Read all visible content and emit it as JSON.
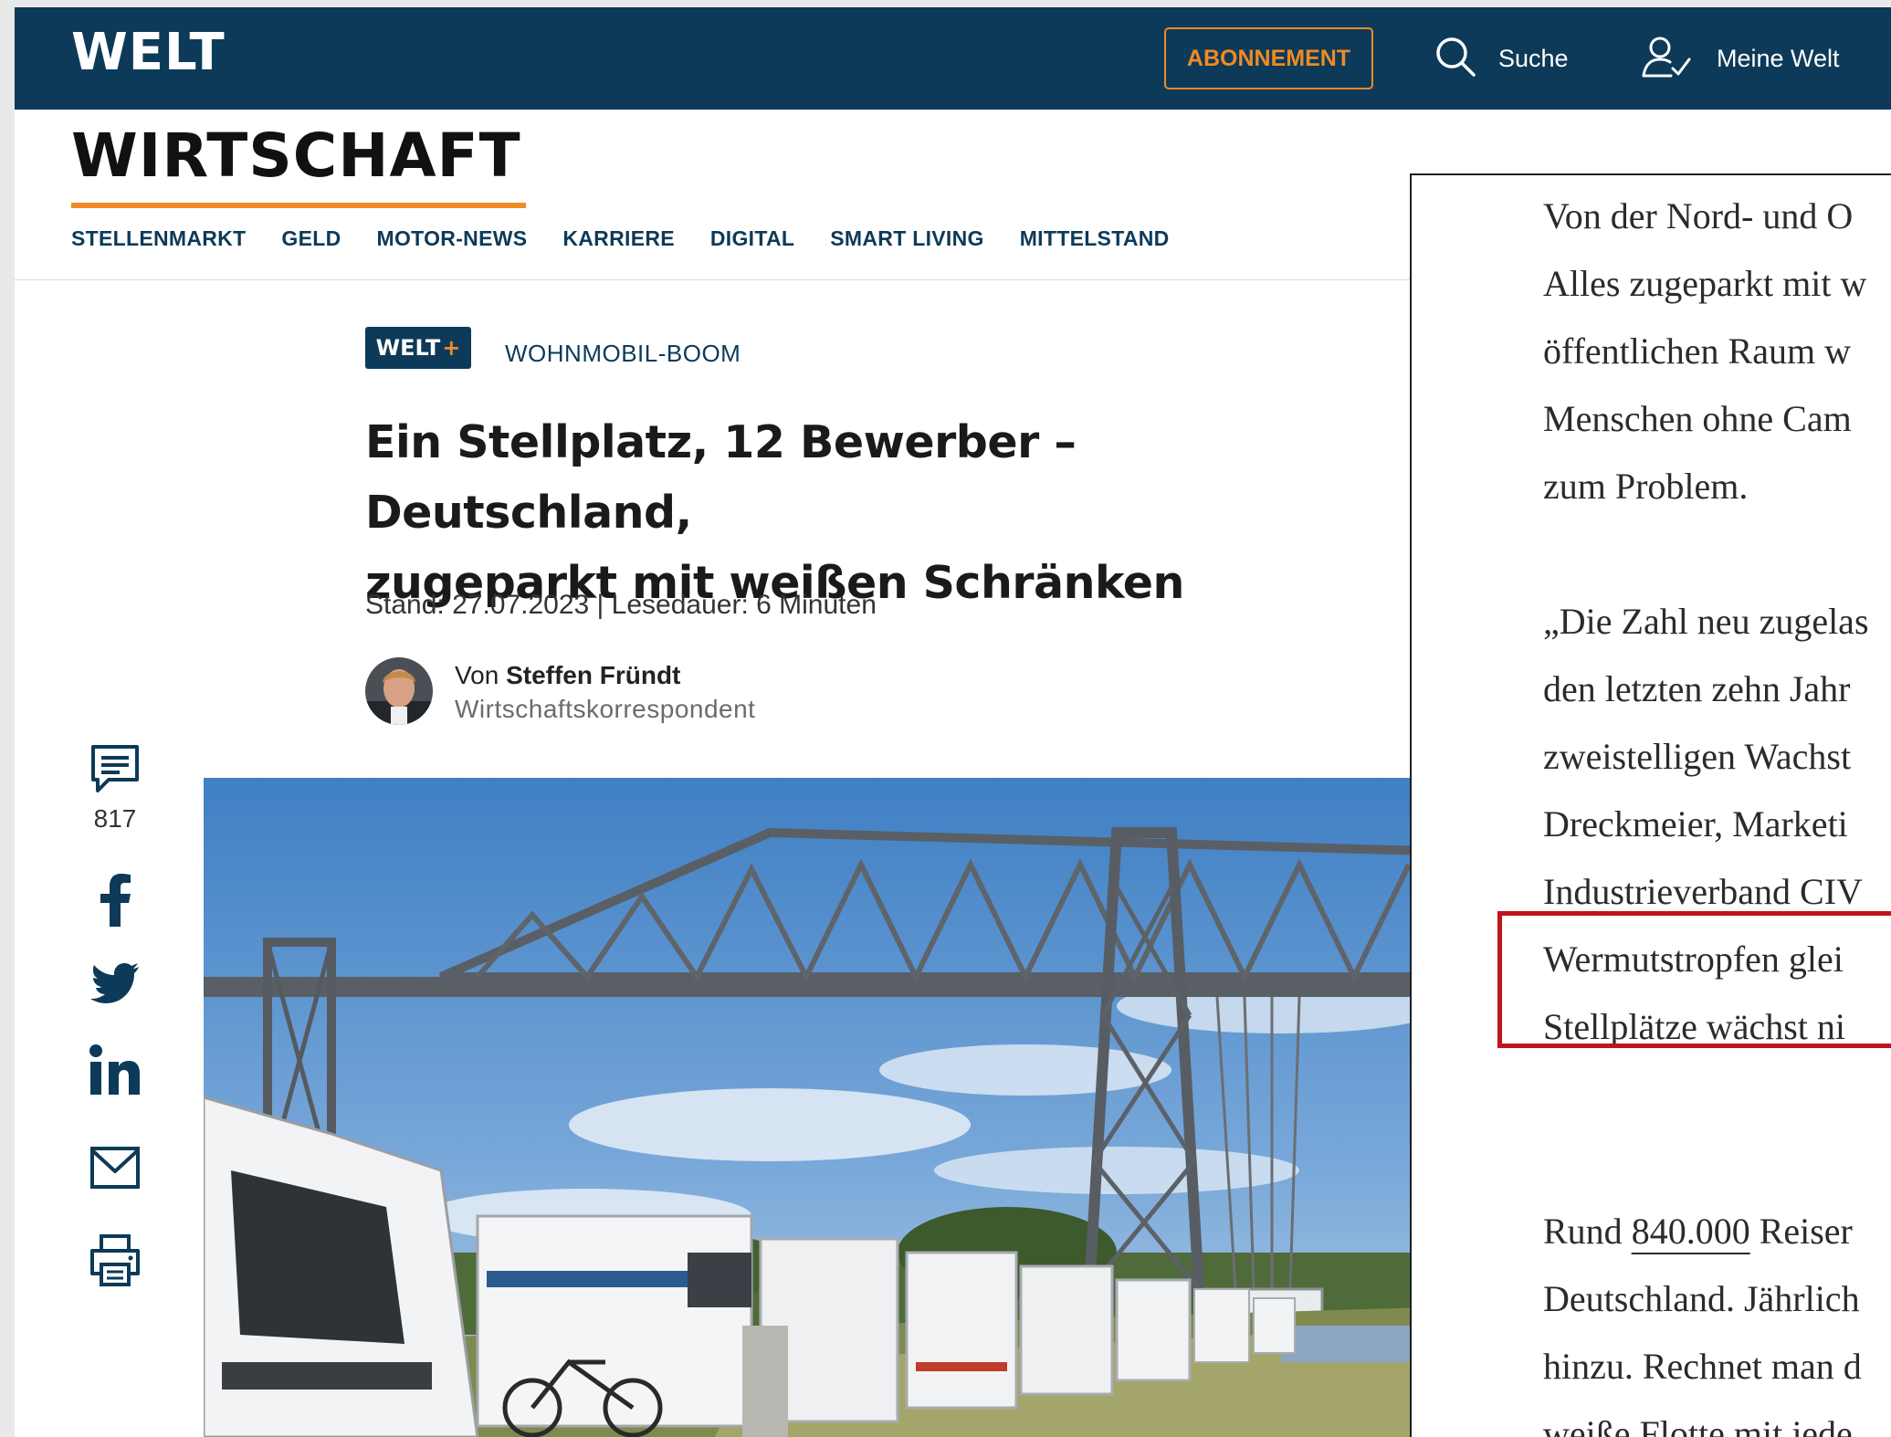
{
  "header": {
    "logo": "WELT",
    "subscribe_label": "ABONNEMENT",
    "search_label": "Suche",
    "account_label": "Meine Welt"
  },
  "section": {
    "title": "WIRTSCHAFT",
    "nav": [
      "STELLENMARKT",
      "GELD",
      "MOTOR-NEWS",
      "KARRIERE",
      "DIGITAL",
      "SMART LIVING",
      "MITTELSTAND"
    ]
  },
  "article": {
    "badge": "WELT",
    "badge_plus": "+",
    "kicker": "WOHNMOBIL-BOOM",
    "headline_line1": "Ein Stellplatz, 12 Bewerber – Deutschland,",
    "headline_line2": "zugeparkt mit weißen Schränken",
    "meta": "Stand: 27.07.2023 | Lesedauer: 6 Minuten",
    "author_prefix": "Von",
    "author_name": "Steffen Fründt",
    "author_role": "Wirtschaftskorrespondent"
  },
  "share": {
    "comment_count": "817",
    "items": [
      "comments",
      "facebook",
      "twitter",
      "linkedin",
      "email",
      "print"
    ]
  },
  "reader": {
    "para1": [
      "Von der Nord- und O",
      "Alles zugeparkt mit w",
      "öffentlichen Raum w",
      "Menschen ohne Cam",
      "zum Problem."
    ],
    "para2": [
      "„Die Zahl neu zugelas",
      "den letzten zehn Jahr",
      "zweistelligen Wachst",
      "Dreckmeier, Marketi",
      "Industrieverband CIV",
      "Wermutstropfen glei",
      "Stellplätze wächst ni"
    ],
    "para3_first_prefix": "Rund ",
    "para3_first_number": "840.000",
    "para3_first_rest": " Reiser",
    "para3_rest": [
      "Deutschland. Jährlich",
      "hinzu. Rechnet man d",
      "weiße Flotte mit jede"
    ]
  },
  "colors": {
    "navy": "#0d3a58",
    "orange": "#f08a24",
    "highlight_red": "#c0141c"
  }
}
